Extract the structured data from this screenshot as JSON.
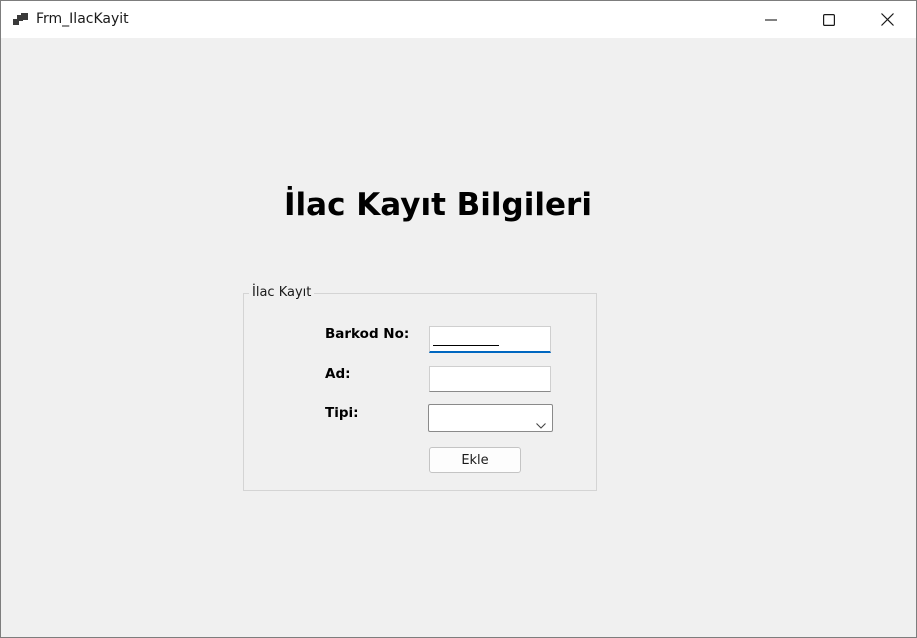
{
  "window": {
    "title": "Frm_IlacKayit",
    "icon": "app-window-icon",
    "controls": [
      "minimize-icon",
      "maximize-icon",
      "close-icon"
    ]
  },
  "form": {
    "heading": "İlac Kayıt Bilgileri",
    "group": {
      "legend": "İlac Kayıt",
      "fields": {
        "barkod": {
          "label": "Barkod No:",
          "value": "",
          "mask": "_________"
        },
        "ad": {
          "label": "Ad:",
          "value": ""
        },
        "tipi": {
          "label": "Tipi:",
          "selected": "",
          "dropdown_icon": "chevron-down-icon"
        }
      },
      "submit_label": "Ekle"
    }
  },
  "colors": {
    "window_bg": "#f0f0f0",
    "titlebar_bg": "#ffffff",
    "focus_accent": "#0067c0"
  }
}
